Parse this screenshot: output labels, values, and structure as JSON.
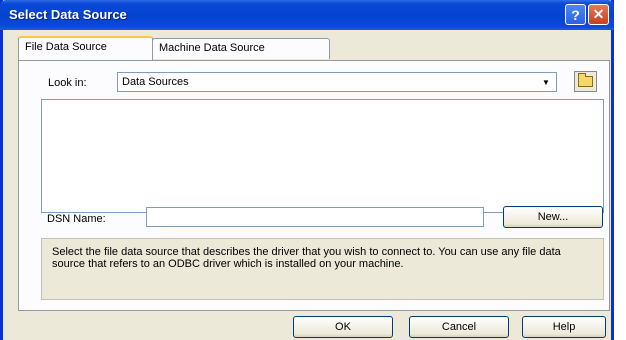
{
  "window": {
    "title": "Select Data Source",
    "help_glyph": "?",
    "close_glyph": "✕"
  },
  "tabs": [
    {
      "label": "File Data Source",
      "active": true
    },
    {
      "label": "Machine Data Source",
      "active": false
    }
  ],
  "look_in": {
    "label": "Look in:",
    "value": "Data Sources",
    "arrow_glyph": "▼"
  },
  "dsn": {
    "label": "DSN Name:",
    "value": "",
    "new_button": "New..."
  },
  "description": "Select the file data source that describes the driver that you wish to connect to. You can use any file data source that refers to an ODBC driver which is installed on your machine.",
  "buttons": {
    "ok": "OK",
    "cancel": "Cancel",
    "help": "Help"
  },
  "colors": {
    "titlebar": "#0542d0",
    "dialog_bg": "#ece9d8",
    "active_tab_accent": "#ffc83c"
  }
}
